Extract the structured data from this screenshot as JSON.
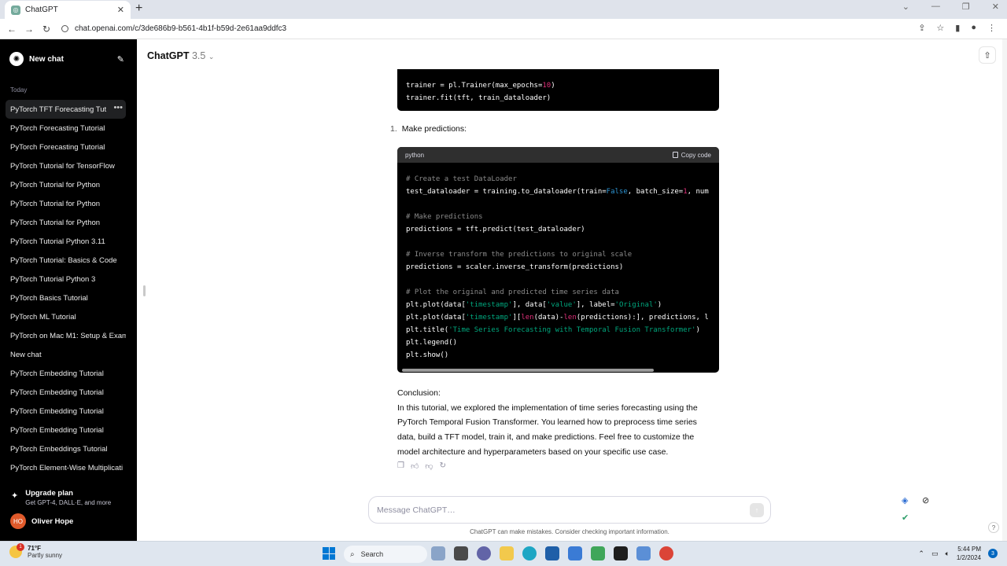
{
  "browser": {
    "tab_title": "ChatGPT",
    "url": "chat.openai.com/c/3de686b9-b561-4b1f-b59d-2e61aa9ddfc3"
  },
  "sidebar": {
    "new_chat_label": "New chat",
    "today_label": "Today",
    "items": [
      "PyTorch TFT Forecasting Tut",
      "PyTorch Forecasting Tutorial",
      "PyTorch Forecasting Tutorial",
      "PyTorch Tutorial for TensorFlow",
      "PyTorch Tutorial for Python",
      "PyTorch Tutorial for Python",
      "PyTorch Tutorial for Python",
      "PyTorch Tutorial Python 3.11",
      "PyTorch Tutorial: Basics & Code",
      "PyTorch Tutorial Python 3",
      "PyTorch Basics Tutorial",
      "PyTorch ML Tutorial",
      "PyTorch on Mac M1: Setup & Exam",
      "New chat",
      "PyTorch Embedding Tutorial",
      "PyTorch Embedding Tutorial",
      "PyTorch Embedding Tutorial",
      "PyTorch Embedding Tutorial",
      "PyTorch Embeddings Tutorial",
      "PyTorch Element-Wise Multiplicati"
    ],
    "upgrade": {
      "title": "Upgrade plan",
      "subtitle": "Get GPT-4, DALL·E, and more"
    },
    "user": {
      "initials": "HO",
      "name": "Oliver Hope"
    }
  },
  "header": {
    "model": "ChatGPT",
    "version": "3.5"
  },
  "chat": {
    "step_number": "1.",
    "step_text": "Make predictions:",
    "code_lang": "python",
    "copy_label": "Copy code",
    "conclusion_title": "Conclusion:",
    "conclusion_body": "In this tutorial, we explored the implementation of time series forecasting using the PyTorch Temporal Fusion Transformer. You learned how to preprocess time series data, build a TFT model, train it, and make predictions. Feel free to customize the model architecture and hyperparameters based on your specific use case."
  },
  "composer": {
    "placeholder": "Message ChatGPT…",
    "disclaimer": "ChatGPT can make mistakes. Consider checking important information."
  },
  "taskbar": {
    "temp": "71°F",
    "condition": "Partly sunny",
    "weather_badge": "1",
    "search_label": "Search",
    "time": "5:44 PM",
    "date": "1/2/2024",
    "notifications": "3"
  },
  "colors": {
    "sidebar_bg": "#000000",
    "code_bg": "#000000",
    "accent_string": "#00a67d",
    "accent_number": "#df3079",
    "accent_keyword": "#2e95d3"
  }
}
